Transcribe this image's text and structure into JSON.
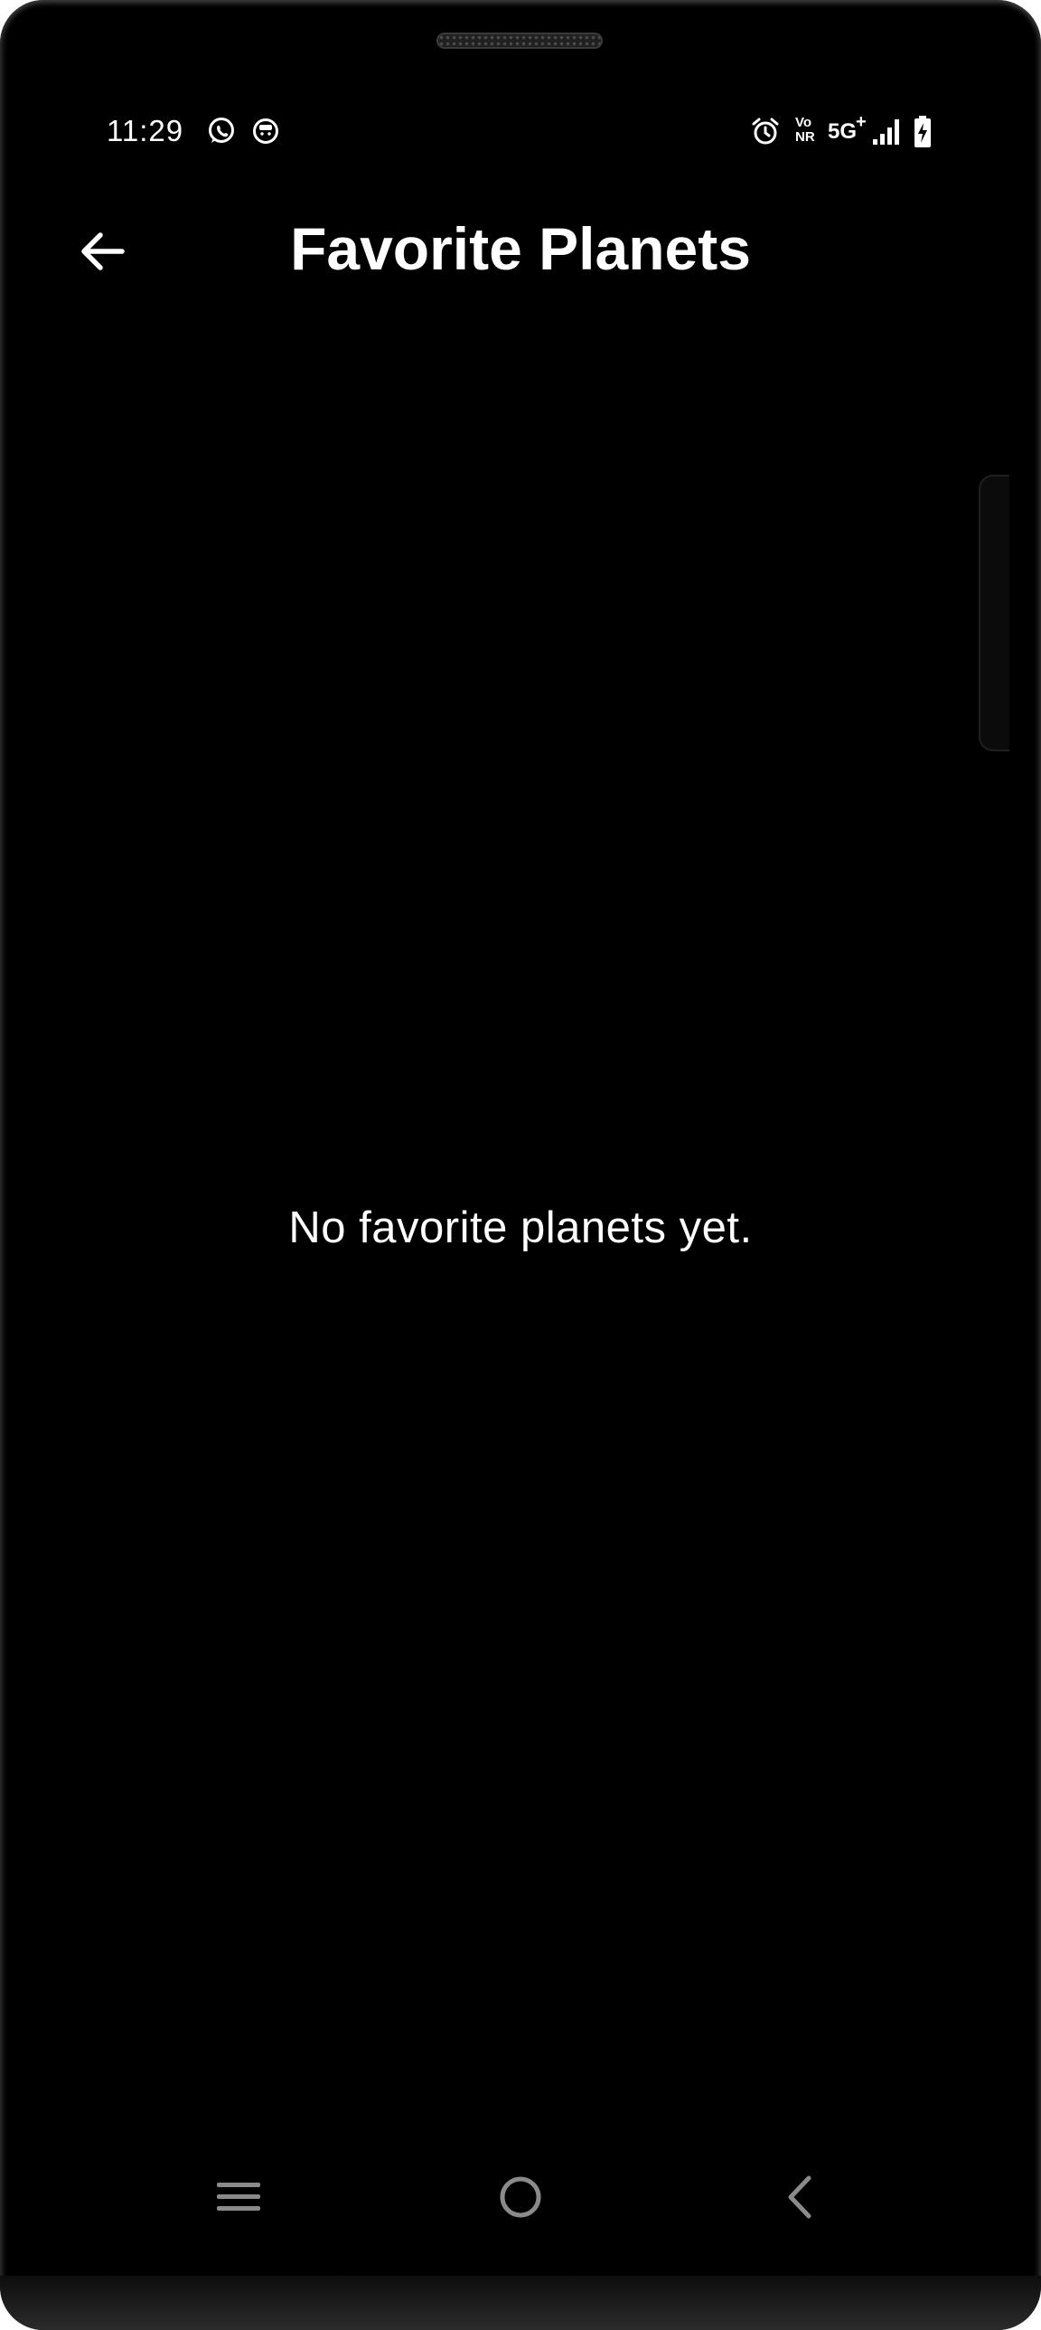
{
  "status_bar": {
    "time": "11:29",
    "network_label": "5G",
    "network_plus": "+",
    "volte_top": "Vo",
    "volte_bottom": "NR",
    "left_icons": [
      "whatsapp-icon",
      "notification-app-icon"
    ],
    "right_icons": [
      "alarm-icon",
      "vonr-icon",
      "5g-plus-icon",
      "signal-icon",
      "battery-charging-icon"
    ]
  },
  "app_bar": {
    "title": "Favorite Planets",
    "back_icon": "arrow-left-icon"
  },
  "main": {
    "empty_message": "No favorite planets yet."
  },
  "nav_bar": {
    "icons": [
      "recents-icon",
      "home-icon",
      "back-icon"
    ]
  },
  "colors": {
    "background": "#000000",
    "text": "#ffffff",
    "nav_icon": "#8a8a8a"
  }
}
